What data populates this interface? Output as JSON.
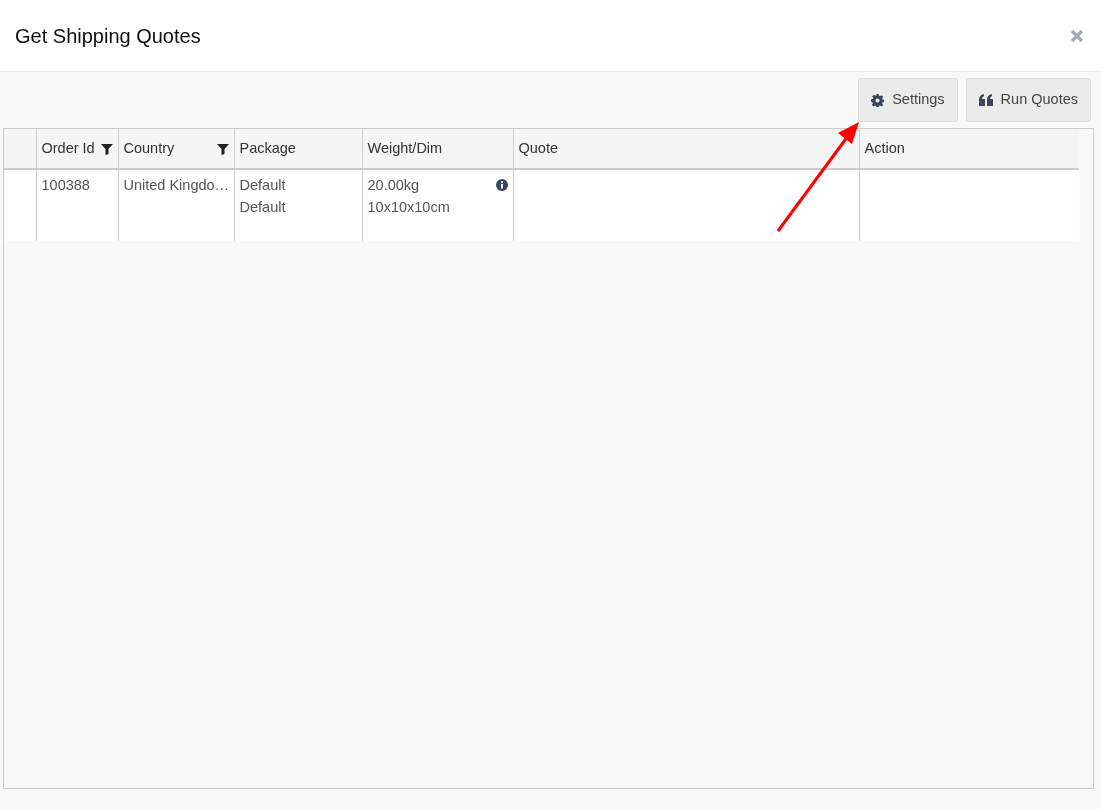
{
  "dialog": {
    "title": "Get Shipping Quotes"
  },
  "toolbar": {
    "buttons": [
      {
        "kind": "settings",
        "label": "Settings"
      },
      {
        "kind": "quotes",
        "label": "Run Quotes"
      }
    ]
  },
  "table": {
    "columns": [
      {
        "filter": false
      },
      {
        "label": "Order Id",
        "filter": true
      },
      {
        "label": "Country",
        "filter": true
      },
      {
        "label": "Package",
        "filter": false
      },
      {
        "label": "Weight/Dim",
        "filter": false
      },
      {
        "label": "Quote",
        "filter": false
      },
      {
        "label": "Action",
        "filter": false
      }
    ],
    "rows": [
      {
        "cells": [
          {
            "info": false
          },
          {
            "lines": [
              "100388"
            ],
            "info": false
          },
          {
            "lines": [
              "United Kingdo…"
            ],
            "info": false
          },
          {
            "lines": [
              "Default",
              "Default"
            ],
            "info": false
          },
          {
            "lines": [
              "20.00kg",
              "10x10x10cm"
            ],
            "info": true
          },
          {
            "info": false
          },
          {
            "info": false
          }
        ]
      }
    ]
  }
}
